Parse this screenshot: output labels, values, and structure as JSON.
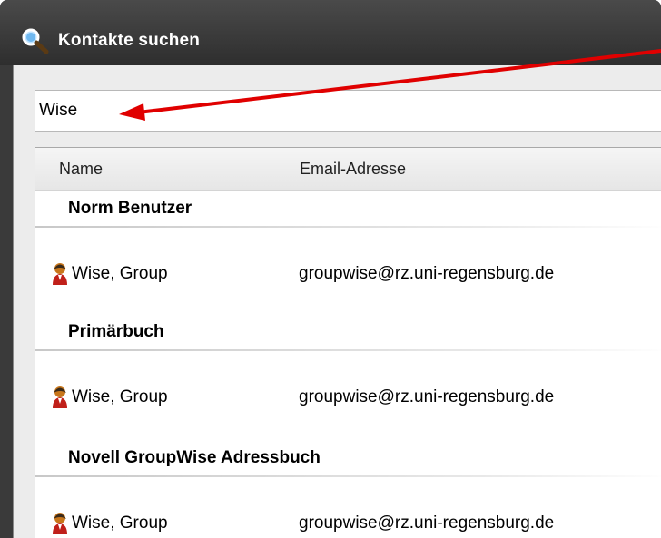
{
  "window": {
    "title": "Kontakte suchen",
    "title_icon": "magnifier-icon"
  },
  "search": {
    "value": "Wise"
  },
  "columns": {
    "name": "Name",
    "email": "Email-Adresse"
  },
  "groups": [
    {
      "title": "Norm Benutzer",
      "rows": [
        {
          "icon": "person-icon",
          "name": "Wise, Group",
          "email": "groupwise@rz.uni-regensburg.de"
        }
      ]
    },
    {
      "title": "Primärbuch",
      "rows": [
        {
          "icon": "person-icon",
          "name": "Wise, Group",
          "email": "groupwise@rz.uni-regensburg.de"
        }
      ]
    },
    {
      "title": "Novell GroupWise Adressbuch",
      "rows": [
        {
          "icon": "person-icon",
          "name": "Wise, Group",
          "email": "groupwise@rz.uni-regensburg.de"
        }
      ]
    }
  ],
  "annotation": {
    "arrow_color": "#e00000"
  }
}
